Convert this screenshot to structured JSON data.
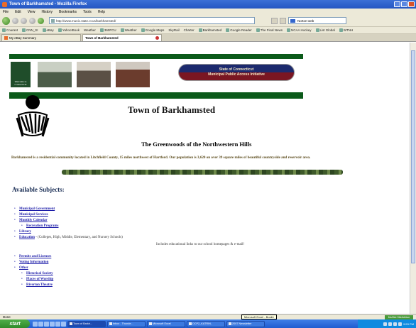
{
  "window": {
    "title": "Town of Barkhamsted - Mozilla Firefox"
  },
  "menu": [
    "File",
    "Edit",
    "View",
    "History",
    "Bookmarks",
    "Tools",
    "Help"
  ],
  "nav": {
    "url": "http://www.munic.state.ct.us/barkhamsted/",
    "search_value": "Norton-web"
  },
  "bookmarks": [
    "Courant",
    "CNN_SI",
    "eBay",
    "Yahoo!Book",
    "Weather",
    "360FCU",
    "Weather",
    "Google Maps",
    "SkyRail",
    "Charter",
    "Barkhamsted",
    "Google Reader",
    "The Final News",
    "NCAA Hockey",
    "List Global",
    "WTNH"
  ],
  "tabs": [
    {
      "label": "My eBay Summary"
    },
    {
      "label": "Town of Barkhamsted"
    }
  ],
  "banner": {
    "logo_text": "Welcome to Connecticut",
    "sign_line1": "State of Connecticut",
    "sign_line2": "Municipal Public Access Initiative"
  },
  "page": {
    "title": "Town of Barkhamsted",
    "subtitle": "The Greenwoods of the Northwestern Hills",
    "description": "Barkhamsted is a residential community located in Litchfield County, 15 miles northwest of Hartford. Our population is 3,620 on over 39 square miles of beautiful countryside and reservoir area.",
    "subjects_heading": "Available Subjects:",
    "list1": [
      {
        "label": "Municipal Government",
        "level": 1
      },
      {
        "label": "Municipal Services",
        "level": 1
      },
      {
        "label": "Monthly Calendar",
        "level": 1
      },
      {
        "label": "Recreation Programs",
        "level": 2
      },
      {
        "label": "Library",
        "level": 1
      },
      {
        "label": "Education",
        "extra": " - (Colleges, High, Middle, Elementary, and Nursery Schools)",
        "level": 1
      }
    ],
    "note": "Includes educational links to our school homepages & e-mail!",
    "list2": [
      {
        "label": "Permits and Licenses",
        "level": 1
      },
      {
        "label": "Voting Information",
        "level": 1
      },
      {
        "label": "Other",
        "level": 1
      },
      {
        "label": "Historical Society",
        "level": 2
      },
      {
        "label": "Places of Worship",
        "level": 2
      },
      {
        "label": "Riverton Theatre",
        "level": 2
      }
    ]
  },
  "status": {
    "text": "Done",
    "tooltip": "Microsoft Excel - Book1",
    "badge": "McAfee SiteAdvisor"
  },
  "taskbar": {
    "start": "start",
    "buttons": [
      "Town of Barkh...",
      "Inbox - Thunde...",
      "Microsoft Excel",
      "DCP2_KATRIN..",
      "2007 Newsletter"
    ],
    "clock": "9:53 PM"
  },
  "colors": {
    "banner_green": "#0b5a1a",
    "link_blue": "#1a1aa8",
    "heading_blue": "#1a2e55",
    "taskbar_blue": "#1f5cd0"
  }
}
